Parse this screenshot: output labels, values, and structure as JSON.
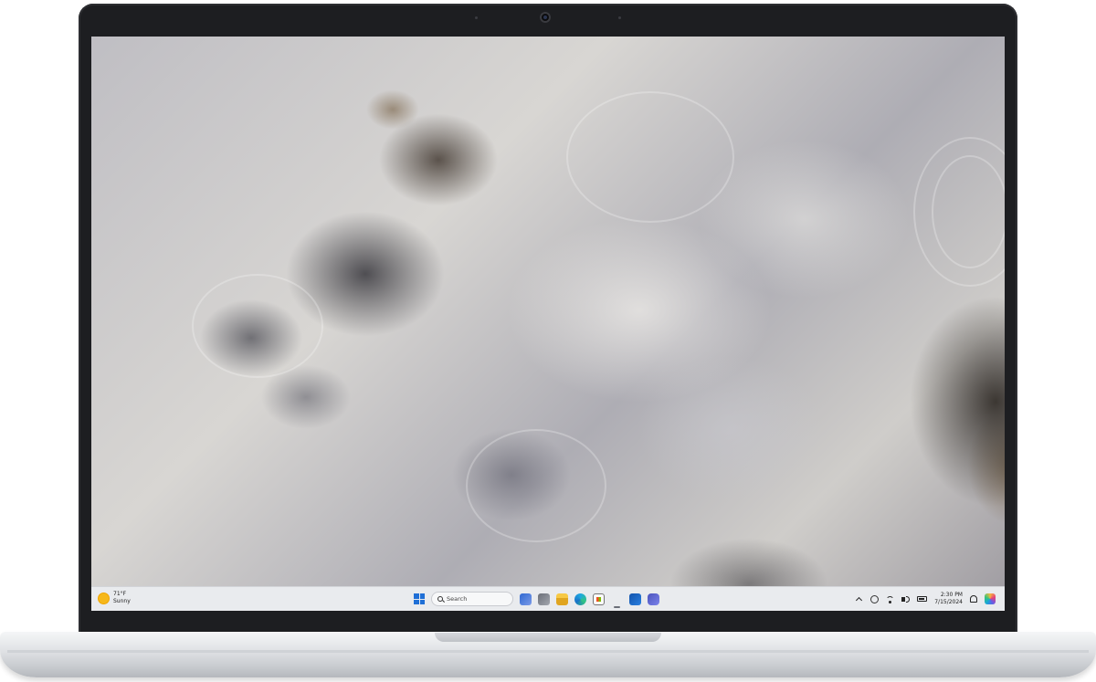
{
  "taskbar": {
    "weather": {
      "temperature": "71°F",
      "condition": "Sunny",
      "icon": "sun-icon"
    },
    "start": {
      "icon": "windows-logo-icon"
    },
    "search": {
      "placeholder": "Search",
      "icon": "search-icon"
    },
    "pinned_apps": [
      {
        "name": "widgets",
        "icon": "widgets-icon"
      },
      {
        "name": "task-view",
        "icon": "task-view-icon"
      },
      {
        "name": "file-explorer",
        "icon": "folder-icon"
      },
      {
        "name": "edge",
        "icon": "edge-browser-icon"
      },
      {
        "name": "store",
        "icon": "store-icon"
      },
      {
        "name": "blank-app",
        "icon": "app-icon"
      },
      {
        "name": "outlook",
        "icon": "outlook-icon"
      },
      {
        "name": "teams",
        "icon": "teams-icon"
      }
    ],
    "tray": {
      "time": "2:30 PM",
      "date": "7/15/2024",
      "icons": [
        "chevron-up-icon",
        "settings-icon",
        "wifi-icon",
        "volume-icon",
        "battery-icon",
        "notification-bell-icon",
        "copilot-icon"
      ]
    }
  },
  "colors": {
    "taskbar_bg": "#e9ebee",
    "bezel": "#1d1e21",
    "chassis": "#e1e3e6",
    "accent": "#1f6fd6"
  }
}
